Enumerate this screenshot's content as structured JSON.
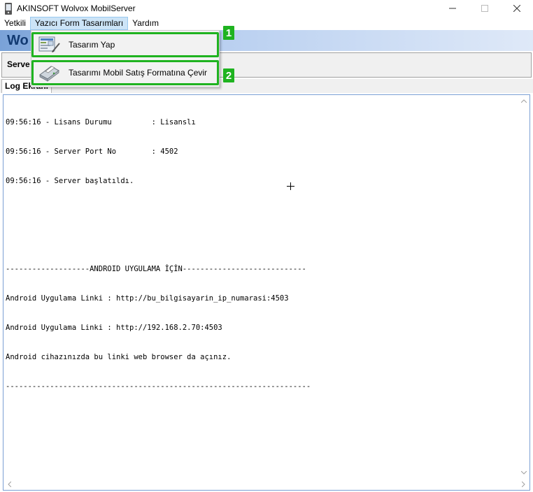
{
  "window": {
    "title": "AKINSOFT Wolvox MobilServer",
    "minimize": "—",
    "maximize": "☐",
    "close": "✕"
  },
  "menu": {
    "items": [
      "Yetkili",
      "Yazıcı Form Tasarımları",
      "Yardım"
    ]
  },
  "banner": {
    "text": "Wo"
  },
  "server_panel": {
    "label": "Serve"
  },
  "tabs": {
    "log": "Log Ekranı"
  },
  "dropdown": {
    "items": [
      {
        "label": "Tasarım Yap",
        "badge": "1"
      },
      {
        "label": "Tasarımı Mobil Satış Formatına Çevir",
        "badge": "2"
      }
    ]
  },
  "log": {
    "lines": [
      "09:56:16 - Lisans Durumu         : Lisanslı",
      "09:56:16 - Server Port No        : 4502",
      "09:56:16 - Server başlatıldı.",
      "",
      "",
      "-------------------ANDROID UYGULAMA İÇİN----------------------------",
      "Android Uygulama Linki : http://bu_bilgisayarin_ip_numarasi:4503",
      "Android Uygulama Linki : http://192.168.2.70:4503",
      "Android cihazınızda bu linki web browser da açınız.",
      "---------------------------------------------------------------------"
    ]
  },
  "colors": {
    "highlight_green": "#1fb320",
    "banner_blue": "#7aa2d8",
    "menu_active": "#cce4f7"
  }
}
